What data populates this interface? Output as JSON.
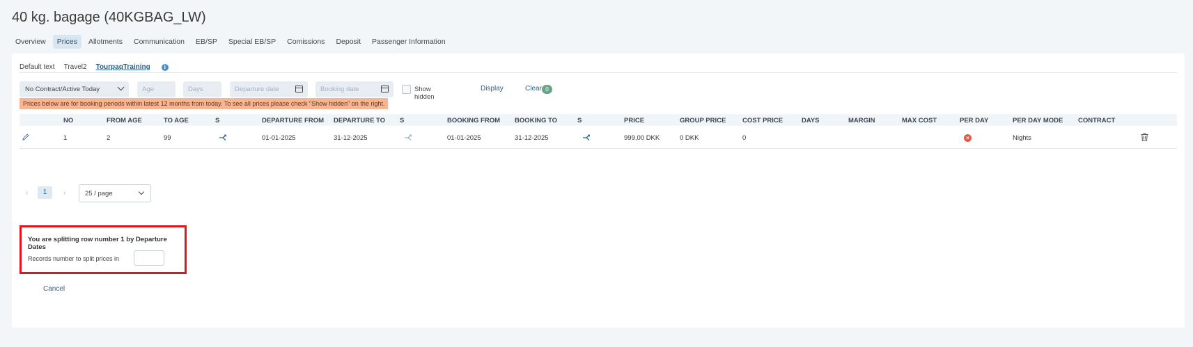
{
  "page": {
    "title": "40 kg. bagage (40KGBAG_LW)"
  },
  "main_tabs": [
    {
      "label": "Overview"
    },
    {
      "label": "Prices"
    },
    {
      "label": "Allotments"
    },
    {
      "label": "Communication"
    },
    {
      "label": "EB/SP"
    },
    {
      "label": "Special EB/SP"
    },
    {
      "label": "Comissions"
    },
    {
      "label": "Deposit"
    },
    {
      "label": "Passenger Information"
    }
  ],
  "sub_tabs": [
    {
      "label": "Default text"
    },
    {
      "label": "Travel2"
    },
    {
      "label": "TourpaqTraining"
    }
  ],
  "info_icon_glyph": "i",
  "filters": {
    "contract_select": "No Contract/Active Today",
    "age_placeholder": "Age",
    "days_placeholder": "Days",
    "departure_date_placeholder": "Departure date",
    "booking_date_placeholder": "Booking date",
    "show_hidden_label": "Show hidden",
    "display_label": "Display",
    "clear_label": "Clear",
    "clear_count": "0"
  },
  "warning_text": "Prices below are for booking periods within latest 12 months from today. To see all prices please check \"Show hidden\" on the right.",
  "table": {
    "headers": {
      "no": "NO",
      "from_age": "FROM AGE",
      "to_age": "TO AGE",
      "s1": "S",
      "departure_from": "DEPARTURE FROM",
      "departure_to": "DEPARTURE TO",
      "s2": "S",
      "booking_from": "BOOKING FROM",
      "booking_to": "BOOKING TO",
      "s3": "S",
      "price": "PRICE",
      "group_price": "GROUP PRICE",
      "cost_price": "COST PRICE",
      "days": "DAYS",
      "margin": "MARGIN",
      "max_cost": "MAX COST",
      "per_day": "PER DAY",
      "per_day_mode": "PER DAY MODE",
      "contract": "CONTRACT"
    },
    "rows": [
      {
        "no": "1",
        "from_age": "2",
        "to_age": "99",
        "departure_from": "01-01-2025",
        "departure_to": "31-12-2025",
        "booking_from": "01-01-2025",
        "booking_to": "31-12-2025",
        "price": "999,00 DKK",
        "group_price": "0 DKK",
        "cost_price": "0",
        "per_day_glyph": "×",
        "per_day_mode": "Nights"
      }
    ]
  },
  "pagination": {
    "current_page": "1",
    "prev_glyph": "‹",
    "next_glyph": "›",
    "page_size": "25 / page"
  },
  "split": {
    "title": "You are splitting row number 1 by Departure Dates",
    "records_label": "Records number to split prices in",
    "records_value": "",
    "cancel_label": "Cancel"
  },
  "colors": {
    "accent": "#2d5f8b",
    "warning_bg": "#f8b591",
    "split_border": "#e0141c",
    "badge": "#6aa58a",
    "error": "#e05a4a"
  }
}
